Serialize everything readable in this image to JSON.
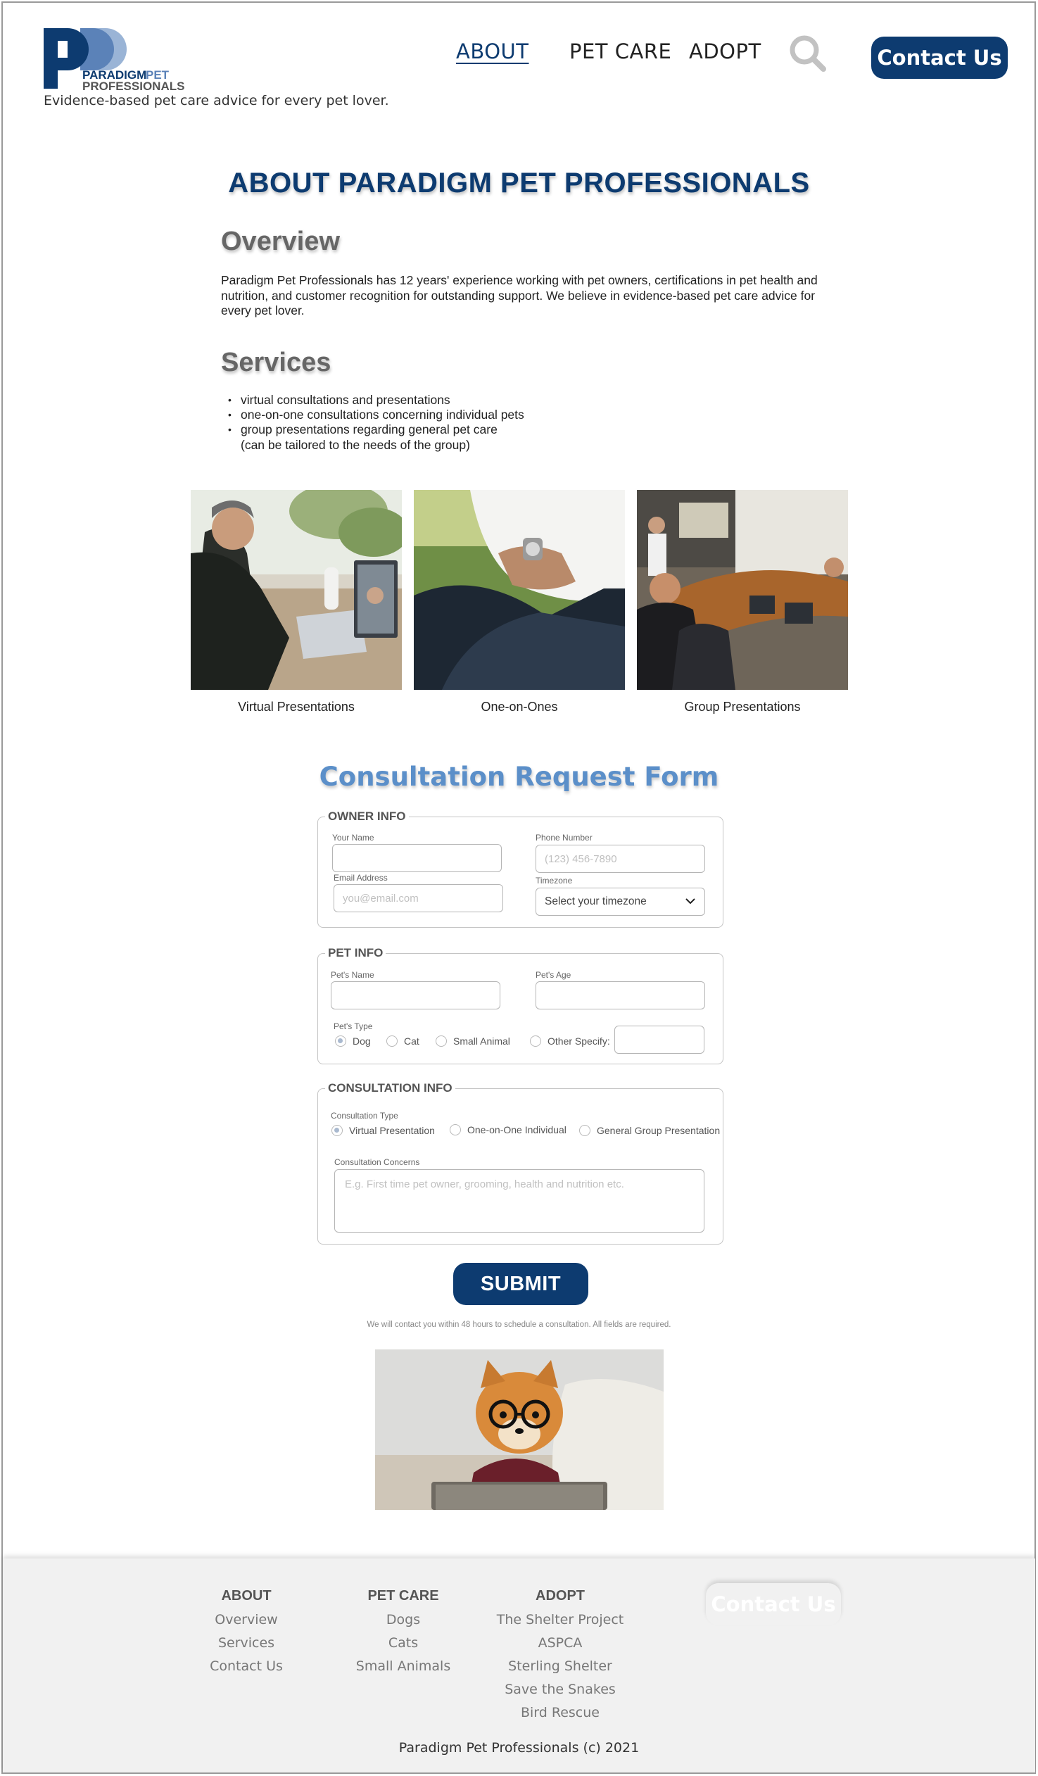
{
  "header": {
    "logo_word1": "PARADIGM",
    "logo_word2": "PET",
    "logo_word3": "PROFESSIONALS",
    "tagline": "Evidence-based pet care advice for every pet lover.",
    "nav": [
      "ABOUT",
      "PET CARE",
      "ADOPT"
    ],
    "contact_label": "Contact Us"
  },
  "main": {
    "title": "ABOUT PARADIGM PET PROFESSIONALS",
    "overview_heading": "Overview",
    "overview_text": "Paradigm Pet Professionals has 12 years' experience working with pet owners, certifications in pet health and nutrition, and customer recognition for outstanding support. We believe in evidence-based pet care advice for every pet lover.",
    "services_heading": "Services",
    "services": [
      "virtual consultations and presentations",
      "one-on-one consultations concerning individual pets",
      "group presentations regarding general pet care"
    ],
    "services_note": "(can be tailored to the needs of the group)",
    "photos": [
      "Virtual Presentations",
      "One-on-Ones",
      "Group Presentations"
    ]
  },
  "form": {
    "title": "Consultation Request Form",
    "owner": {
      "legend": "OWNER INFO",
      "name_label": "Your Name",
      "phone_label": "Phone Number",
      "phone_placeholder": "(123) 456-7890",
      "email_label": "Email Address",
      "email_placeholder": "you@email.com",
      "timezone_label": "Timezone",
      "timezone_value": "Select your timezone"
    },
    "pet": {
      "legend": "PET INFO",
      "name_label": "Pet's Name",
      "age_label": "Pet's Age",
      "type_label": "Pet's Type",
      "types": [
        "Dog",
        "Cat",
        "Small Animal",
        "Other Specify:"
      ]
    },
    "consultation": {
      "legend": "CONSULTATION INFO",
      "type_label": "Consultation Type",
      "types": [
        "Virtual Presentation",
        "One-on-One Individual",
        "General Group Presentation"
      ],
      "concerns_label": "Consultation Concerns",
      "concerns_placeholder": "E.g. First time pet owner, grooming, health and nutrition etc."
    },
    "submit_label": "SUBMIT",
    "note": "We will contact you within 48 hours to schedule a consultation. All fields are required."
  },
  "footer": {
    "columns": [
      {
        "heading": "ABOUT",
        "links": [
          "Overview",
          "Services",
          "Contact Us"
        ]
      },
      {
        "heading": "PET CARE",
        "links": [
          "Dogs",
          "Cats",
          "Small Animals"
        ]
      },
      {
        "heading": "ADOPT",
        "links": [
          "The Shelter Project",
          "ASPCA",
          "Sterling Shelter",
          "Save the Snakes",
          "Bird Rescue"
        ]
      }
    ],
    "contact_label": "Contact Us",
    "copyright": "Paradigm Pet Professionals (c) 2021"
  },
  "colors": {
    "brand_navy": "#0d3b70",
    "form_title_blue": "#5b8fc9",
    "heading_gray": "#666666"
  },
  "icons": [
    "search-icon",
    "chevron-down-icon"
  ]
}
